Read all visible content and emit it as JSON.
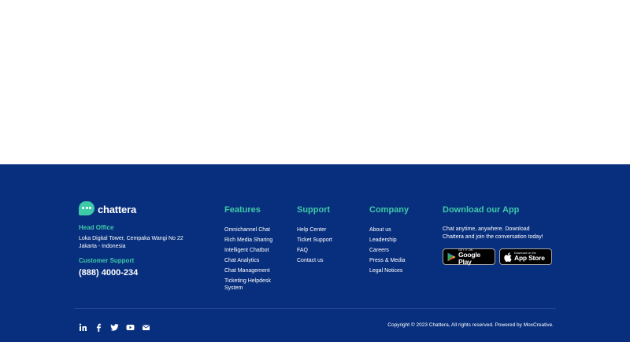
{
  "brand": {
    "name": "chattera",
    "head_office_label": "Head Office",
    "address_line1": "Loka Digital Tower, Cempaka Wangi No 22",
    "address_line2": "Jakarta - Indonesia",
    "support_label": "Customer Support",
    "phone": "(888) 4000-234"
  },
  "features": {
    "title": "Features",
    "items": [
      "Omnichannel Chat",
      "Rich Media Sharing",
      "Intelligent Chatbot",
      "Chat Analytics",
      "Chat Management",
      "Ticketing Helpdesk",
      "System"
    ]
  },
  "support": {
    "title": "Support",
    "items": [
      "Help Center",
      "Ticket Support",
      "FAQ",
      "Contact us"
    ]
  },
  "company": {
    "title": "Company",
    "items": [
      "About us",
      "Leadership",
      "Careers",
      "Press & Media",
      "Legal Notices"
    ]
  },
  "app": {
    "title": "Download our App",
    "text_line1": "Chat anytime, anywhere. Download",
    "text_line2": "Chattera and join the conversation today!",
    "google_small": "GET IT ON",
    "google_big": "Google Play",
    "apple_small": "Download on the",
    "apple_big": "App Store"
  },
  "social_icons": [
    "linkedin-icon",
    "facebook-icon",
    "twitter-icon",
    "youtube-icon",
    "mail-icon"
  ],
  "copyright": "Copyright © 2023 Chattera, All rights reserved. Powered by MoxCreative.",
  "colors": {
    "footer_bg": "#082f7e",
    "accent": "#3ec9a7",
    "divider": "#23478f"
  }
}
